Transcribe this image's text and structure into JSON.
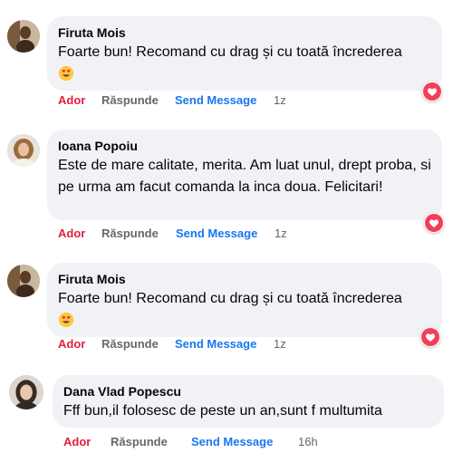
{
  "comments": [
    {
      "author": "Firuta Mois",
      "text": "Foarte bun! Recomand cu drag și cu toată încrederea",
      "emoji": "smiling-face-with-heart-eyes",
      "like_label": "Ador",
      "reply_label": "Răspunde",
      "send_label": "Send Message",
      "time": "1z"
    },
    {
      "author": "Ioana Popoiu",
      "text": "Este de mare calitate, merita. Am luat unul, drept proba, si pe urma am facut comanda la inca doua. Felicitari!",
      "like_label": "Ador",
      "reply_label": "Răspunde",
      "send_label": "Send Message",
      "time": "1z"
    },
    {
      "author": "Firuta Mois",
      "text": "Foarte bun! Recomand cu drag și cu toată încrederea",
      "emoji": "smiling-face-with-heart-eyes",
      "like_label": "Ador",
      "reply_label": "Răspunde",
      "send_label": "Send Message",
      "time": "1z"
    },
    {
      "author": "Dana Vlad Popescu",
      "text": "Fff bun,il folosesc de peste un an,sunt f multumita",
      "like_label": "Ador",
      "reply_label": "Răspunde",
      "send_label": "Send Message",
      "time": "16h"
    }
  ],
  "reaction_icon": "heart-reaction-icon",
  "colors": {
    "bubble": "#f0f2f5",
    "like": "#e41e3f",
    "send": "#1877f2",
    "muted": "#65676b",
    "heart": "#f33e58"
  }
}
